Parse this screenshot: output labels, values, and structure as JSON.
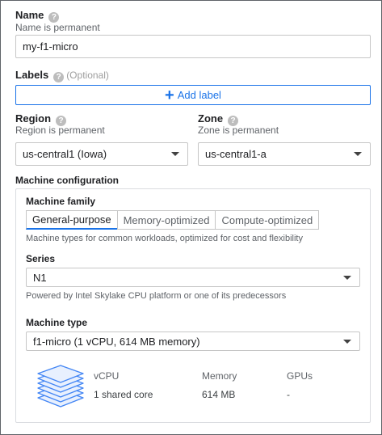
{
  "name": {
    "label": "Name",
    "hint": "Name is permanent",
    "value": "my-f1-micro"
  },
  "labels": {
    "label": "Labels",
    "optional": "(Optional)",
    "add_button": "Add label"
  },
  "region": {
    "label": "Region",
    "hint": "Region is permanent",
    "value": "us-central1 (Iowa)"
  },
  "zone": {
    "label": "Zone",
    "hint": "Zone is permanent",
    "value": "us-central1-a"
  },
  "machine_config": {
    "heading": "Machine configuration",
    "family_label": "Machine family",
    "tabs": [
      {
        "label": "General-purpose",
        "active": true
      },
      {
        "label": "Memory-optimized",
        "active": false
      },
      {
        "label": "Compute-optimized",
        "active": false
      }
    ],
    "family_description": "Machine types for common workloads, optimized for cost and flexibility",
    "series_label": "Series",
    "series_value": "N1",
    "series_description": "Powered by Intel Skylake CPU platform or one of its predecessors",
    "type_label": "Machine type",
    "type_value": "f1-micro (1 vCPU, 614 MB memory)",
    "specs": {
      "headers": [
        "vCPU",
        "Memory",
        "GPUs"
      ],
      "values": [
        "1 shared core",
        "614 MB",
        "-"
      ]
    }
  },
  "icons": {
    "help": "help-icon",
    "add": "plus-icon",
    "dropdown": "dropdown-caret-icon",
    "machine": "layers-stack-icon"
  },
  "colors": {
    "accent": "#1a73e8",
    "stack_fill": "#e8f0fe",
    "stack_stroke": "#4285f4"
  }
}
